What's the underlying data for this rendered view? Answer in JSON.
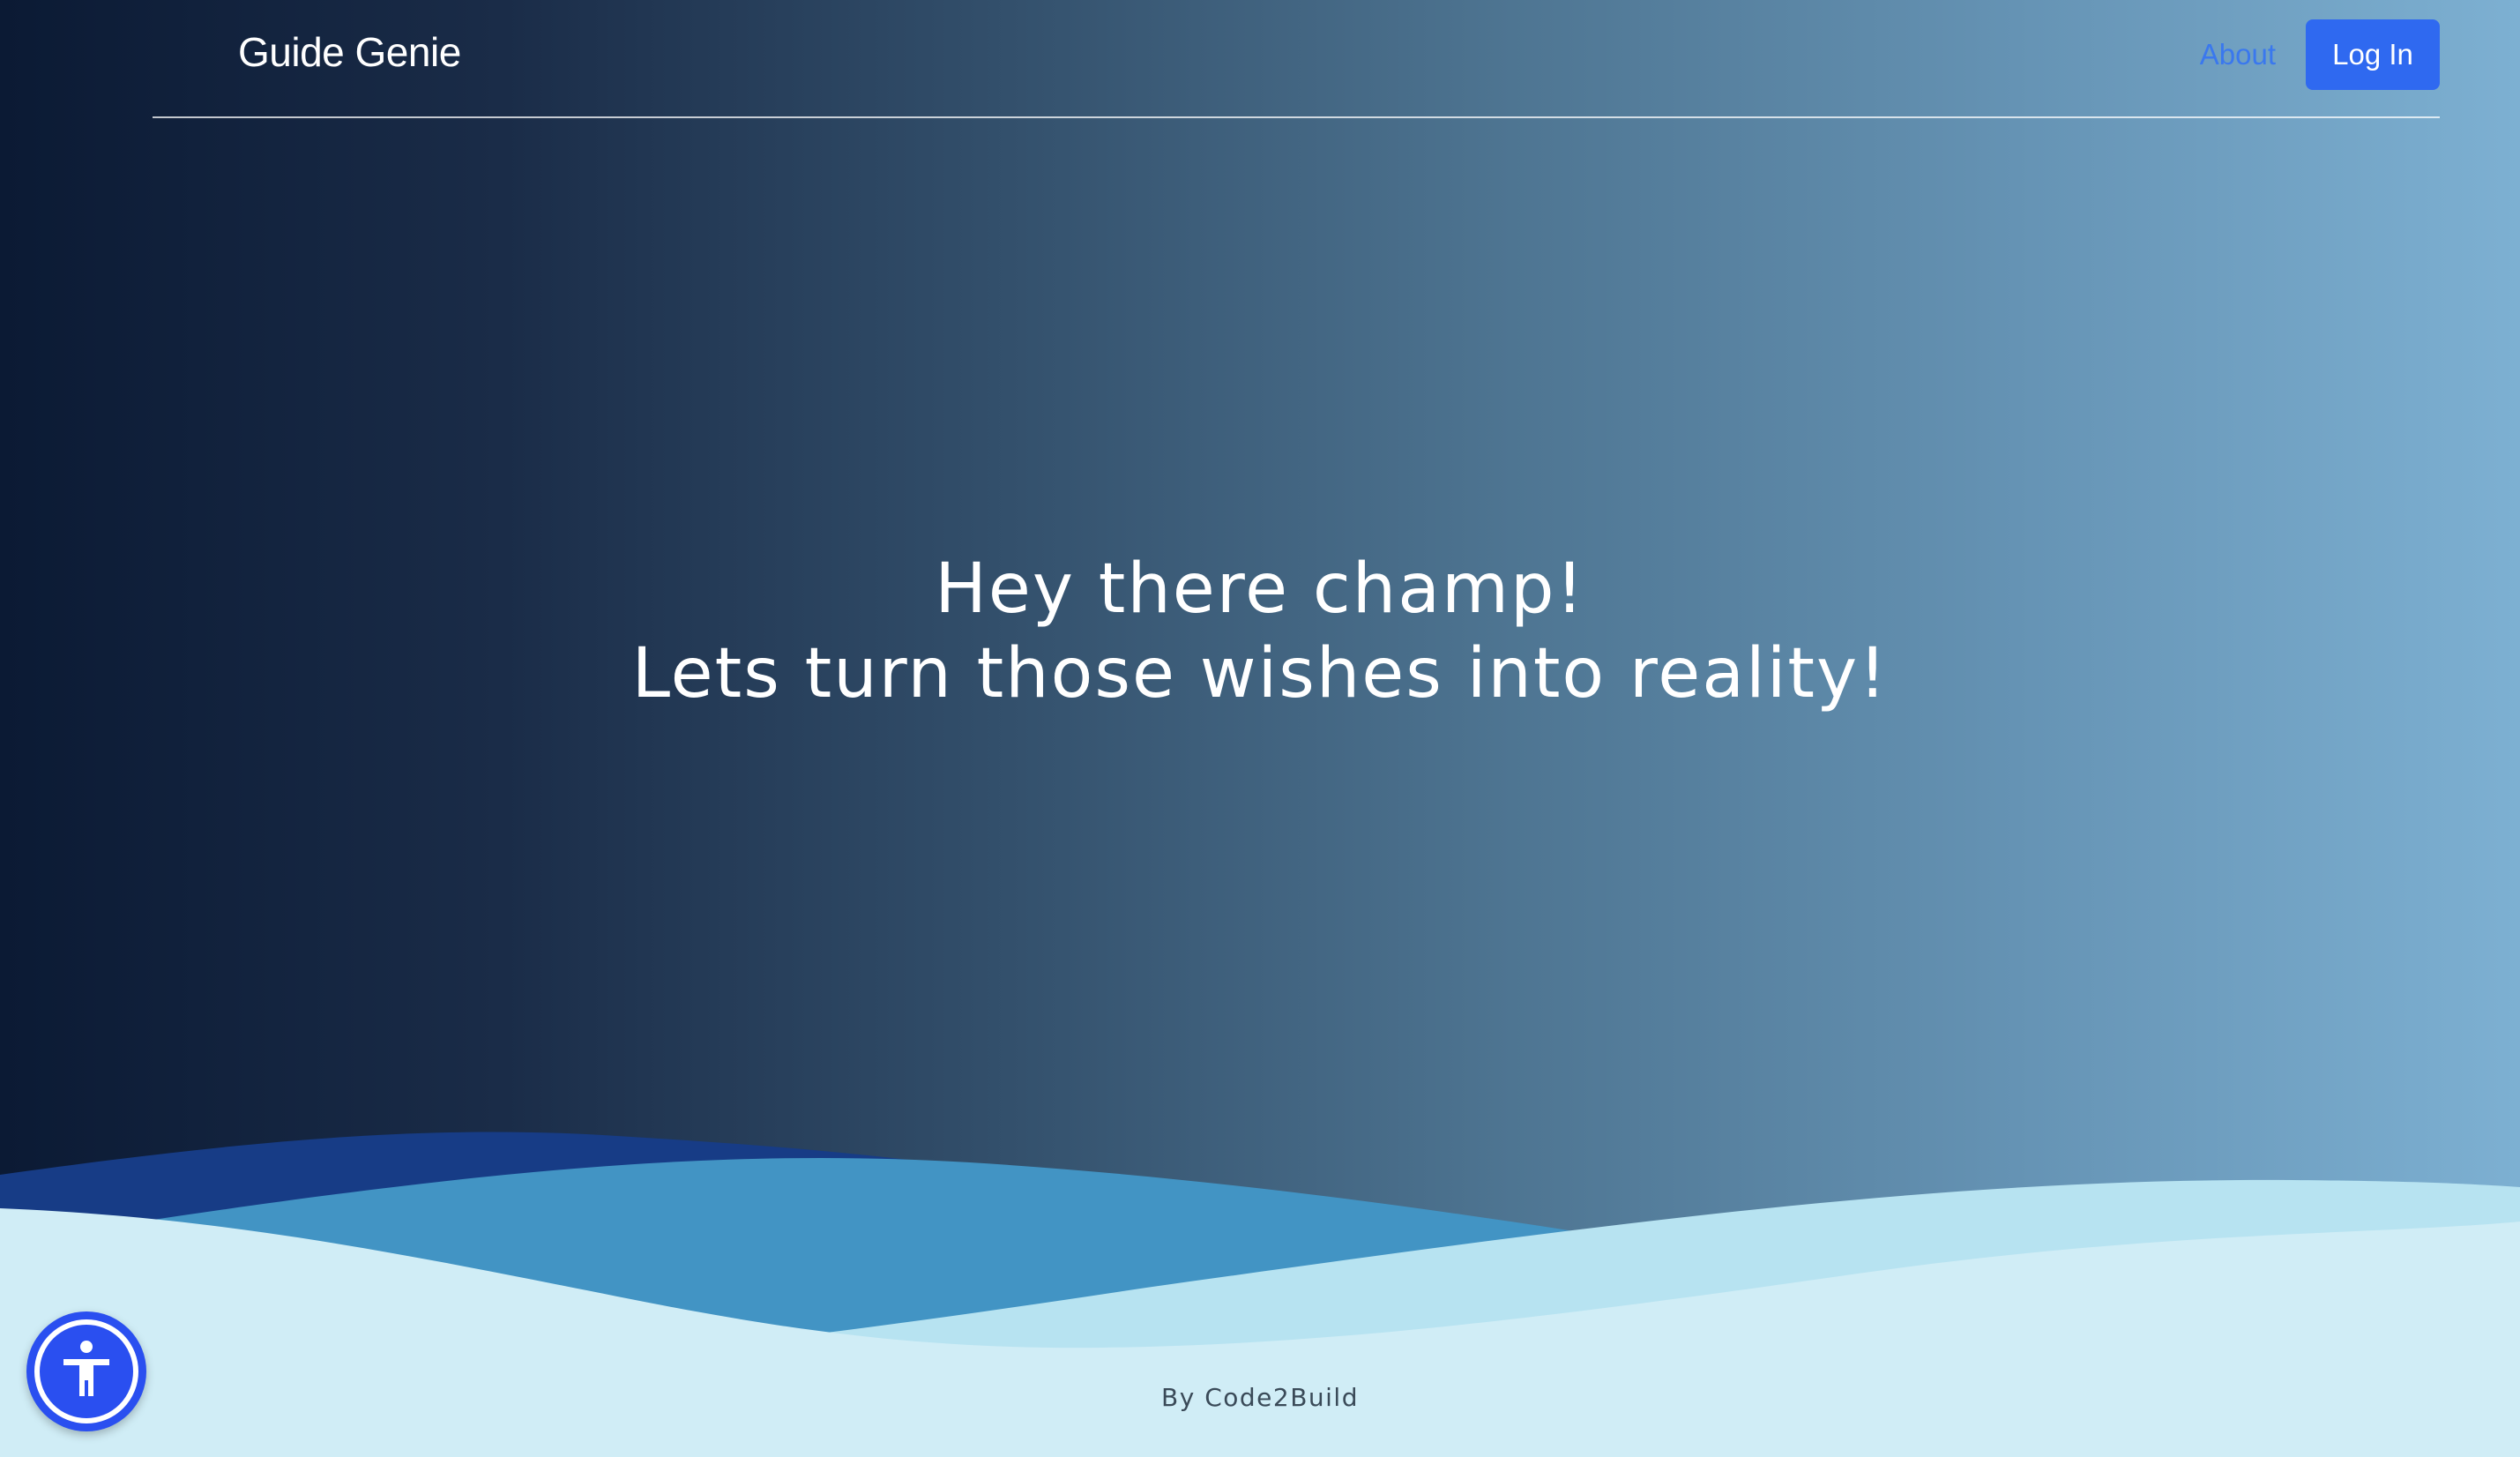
{
  "header": {
    "brand": "Guide Genie",
    "nav": {
      "about_label": "About",
      "login_label": "Log In"
    }
  },
  "hero": {
    "line1": "Hey there champ!",
    "line2": "Lets turn those wishes into reality!"
  },
  "footer": {
    "credit": "By Code2Build"
  },
  "accessibility": {
    "icon": "accessibility-icon"
  },
  "colors": {
    "primary": "#2f69f0",
    "link": "#3a78ee",
    "wave_dark": "#173c86",
    "wave_mid": "#4294c4",
    "wave_light": "#b7e3f1",
    "wave_lightest": "#d0edf6"
  }
}
